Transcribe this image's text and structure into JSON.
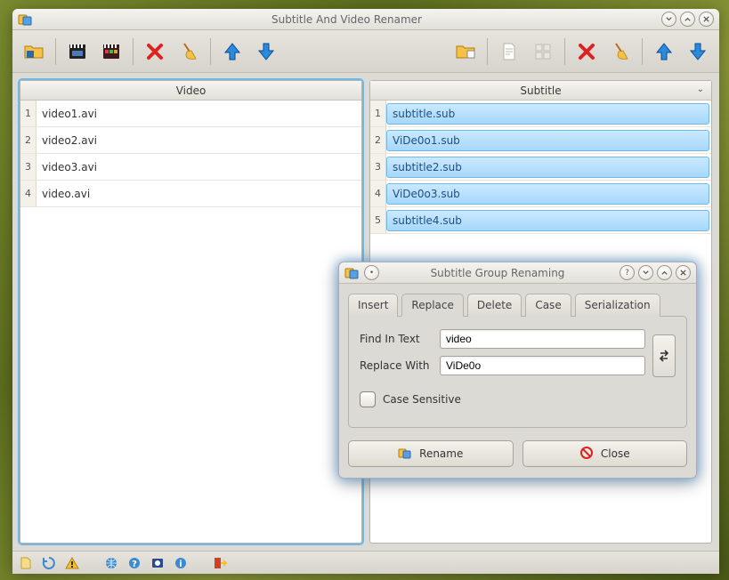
{
  "main": {
    "title": "Subtitle And Video Renamer"
  },
  "video": {
    "header": "Video",
    "rows": [
      "video1.avi",
      "video2.avi",
      "video3.avi",
      "video.avi"
    ]
  },
  "subtitle": {
    "header": "Subtitle",
    "rows": [
      "subtitle.sub",
      "ViDe0o1.sub",
      "subtitle2.sub",
      "ViDe0o3.sub",
      "subtitle4.sub"
    ]
  },
  "dialog": {
    "title": "Subtitle Group Renaming",
    "tabs": {
      "insert": "Insert",
      "replace": "Replace",
      "delete": "Delete",
      "case": "Case",
      "serialization": "Serialization"
    },
    "replace": {
      "find_label": "Find In Text",
      "find_value": "video",
      "with_label": "Replace With",
      "with_value": "ViDe0o",
      "case_sensitive_label": "Case Sensitive"
    },
    "buttons": {
      "rename": "Rename",
      "close": "Close"
    }
  },
  "icons": {
    "app": "app-icon",
    "open_folder": "folder-open-icon",
    "clapper": "clapperboard-icon",
    "clapper_color": "clapperboard-color-icon",
    "delete": "delete-x-icon",
    "clean": "broom-icon",
    "up": "arrow-up-icon",
    "down": "arrow-down-icon",
    "file": "file-icon",
    "grid": "grid-icon",
    "swap": "swap-icon",
    "rename": "rename-icon",
    "forbidden": "no-entry-icon"
  }
}
